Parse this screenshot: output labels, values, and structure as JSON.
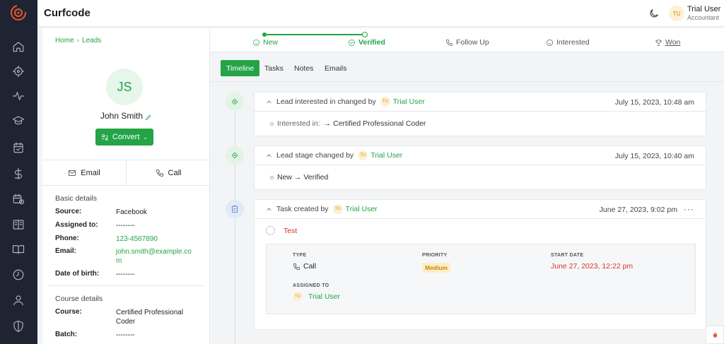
{
  "app": {
    "name": "Curfcode"
  },
  "user": {
    "initials": "TU",
    "name": "Trial User",
    "role": "Accountant"
  },
  "breadcrumb": {
    "home": "Home",
    "separator": "›",
    "current": "Leads"
  },
  "lead": {
    "initials": "JS",
    "name": "John Smith",
    "convert_label": "Convert",
    "actions": {
      "email": "Email",
      "call": "Call"
    },
    "basic_details": {
      "title": "Basic details",
      "rows": [
        {
          "label": "Source:",
          "value": "Facebook"
        },
        {
          "label": "Assigned to:",
          "value": "--------"
        },
        {
          "label": "Phone:",
          "value": "123-4567890"
        },
        {
          "label": "Email:",
          "value": "john.smith@example.com"
        },
        {
          "label": "Date of birth:",
          "value": "--------"
        }
      ]
    },
    "course_details": {
      "title": "Course details",
      "rows": [
        {
          "label": "Course:",
          "value": "Certified Professional Coder"
        },
        {
          "label": "Batch:",
          "value": "--------"
        }
      ]
    }
  },
  "stages": [
    {
      "label": "New",
      "state": "done"
    },
    {
      "label": "Verified",
      "state": "current"
    },
    {
      "label": "Follow Up",
      "state": "pending"
    },
    {
      "label": "Interested",
      "state": "pending"
    },
    {
      "label": "Won",
      "state": "pending"
    }
  ],
  "tabs": [
    "Timeline",
    "Tasks",
    "Notes",
    "Emails"
  ],
  "timeline": [
    {
      "head": "Lead interested in changed by",
      "user": "Trial User",
      "user_initials": "TU",
      "time": "July 15, 2023, 10:48 am",
      "body_label": "Interested in:",
      "body_value": "→ Certified Professional Coder"
    },
    {
      "head": "Lead stage changed by",
      "user": "Trial User",
      "user_initials": "TU",
      "time": "July 15, 2023, 10:40 am",
      "body_value": "New → Verified"
    },
    {
      "head": "Task created by",
      "user": "Trial User",
      "user_initials": "TU",
      "time": "June 27, 2023, 9:02 pm",
      "more": "···",
      "task": {
        "title": "Test",
        "type_label": "TYPE",
        "type_value": "Call",
        "priority_label": "PRIORITY",
        "priority_value": "Medium",
        "start_label": "START DATE",
        "start_value": "June 27, 2023, 12:22 pm",
        "assigned_label": "ASSIGNED TO",
        "assigned_initials": "TU",
        "assigned_value": "Trial User"
      }
    }
  ],
  "colors": {
    "accent": "#22a447",
    "rail": "#1f2433",
    "danger": "#d9342b",
    "warning": "#c58a00"
  }
}
